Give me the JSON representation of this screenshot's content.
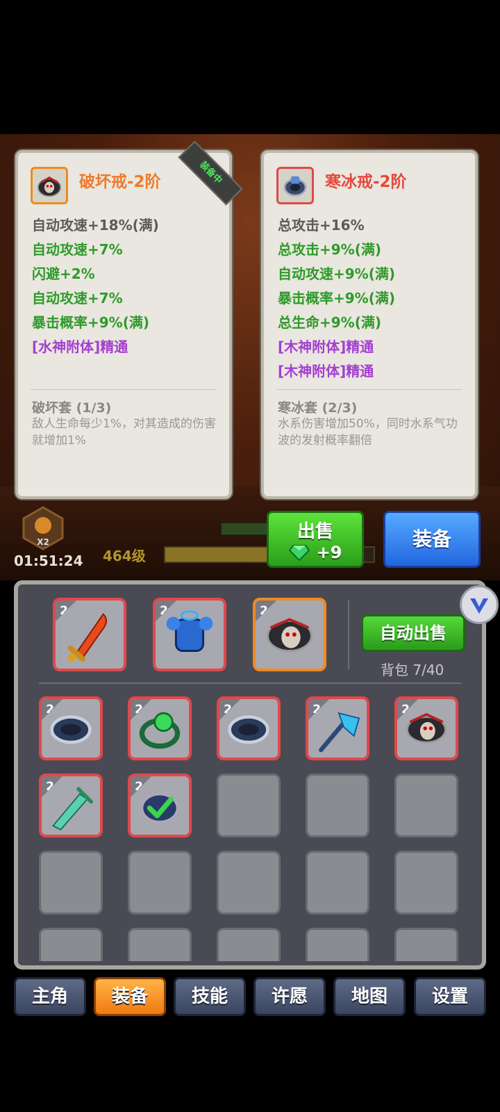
{
  "left_card": {
    "title": "破坏戒-2阶",
    "ribbon": "装备中",
    "stats": [
      {
        "text": "自动攻速+18%(满)",
        "color": "gray"
      },
      {
        "text": "自动攻速+7%",
        "color": "green"
      },
      {
        "text": "闪避+2%",
        "color": "green"
      },
      {
        "text": "自动攻速+7%",
        "color": "green"
      },
      {
        "text": "暴击概率+9%(满)",
        "color": "green"
      },
      {
        "text": "[水神附体]精通",
        "color": "purple"
      }
    ],
    "set_name": "破坏套 (1/3)",
    "set_desc": "敌人生命每少1%，对其造成的伤害就增加1%"
  },
  "right_card": {
    "title": "寒冰戒-2阶",
    "stats": [
      {
        "text": "总攻击+16%",
        "color": "gray"
      },
      {
        "text": "总攻击+9%(满)",
        "color": "green"
      },
      {
        "text": "自动攻速+9%(满)",
        "color": "green"
      },
      {
        "text": "暴击概率+9%(满)",
        "color": "green"
      },
      {
        "text": "总生命+9%(满)",
        "color": "green"
      },
      {
        "text": "[木神附体]精通",
        "color": "purple"
      },
      {
        "text": "[木神附体]精通",
        "color": "purple"
      }
    ],
    "set_name": "寒冰套 (2/3)",
    "set_desc": "水系伤害增加50%，同时水系气功波的发射概率翻倍"
  },
  "hud": {
    "multiplier": "X2",
    "timer": "01:51:24",
    "level": "464级",
    "xp_fraction": 0.6
  },
  "actions": {
    "sell_label": "出售",
    "sell_reward": "+9",
    "equip_label": "装备"
  },
  "inventory": {
    "auto_sell_label": "自动出售",
    "bag_label": "背包 7/40",
    "equipped": [
      {
        "level": "2",
        "icon": "fire-sword-icon"
      },
      {
        "level": "2",
        "icon": "blue-armor-icon"
      },
      {
        "level": "2",
        "icon": "skull-ring-icon"
      }
    ],
    "items": [
      {
        "level": "2",
        "icon": "silver-ring-icon"
      },
      {
        "level": "2",
        "icon": "emerald-ring-icon"
      },
      {
        "level": "2",
        "icon": "silver-ring-icon"
      },
      {
        "level": "2",
        "icon": "ice-axe-icon"
      },
      {
        "level": "2",
        "icon": "skull-ring-icon"
      },
      {
        "level": "2",
        "icon": "jade-sword-icon"
      },
      {
        "level": "2",
        "icon": "ice-ring-equipped-icon"
      }
    ]
  },
  "tabs": [
    "主角",
    "装备",
    "技能",
    "许愿",
    "地图",
    "设置"
  ],
  "active_tab": "装备",
  "colors": {
    "gray_stat": "#5d5a55",
    "green_stat": "#2f9a2a",
    "purple_stat": "#a53ed1",
    "left_title": "#f07a2a",
    "right_title": "#e8483a"
  }
}
